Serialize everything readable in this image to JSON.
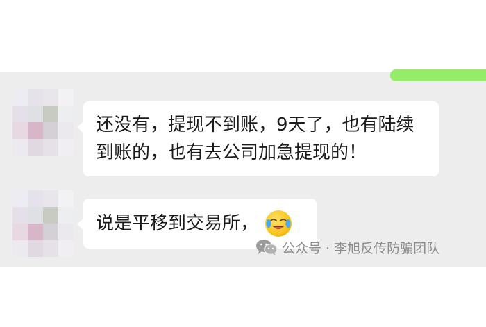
{
  "messages": [
    {
      "text": "还没有，提现不到账，9天了，也有陆续到账的，也有去公司加急提现的！"
    },
    {
      "text": "说是平移到交易所，",
      "emoji": "crying-laughing-face-icon"
    }
  ],
  "watermark": {
    "text": "公众号 · 李旭反传防骗团队",
    "icon": "wechat-icon"
  },
  "colors": {
    "chat_background": "#ededed",
    "bubble_incoming": "#ffffff",
    "bubble_outgoing": "#95ec69",
    "text": "#1a1a1a",
    "watermark": "#8c8c8c"
  }
}
